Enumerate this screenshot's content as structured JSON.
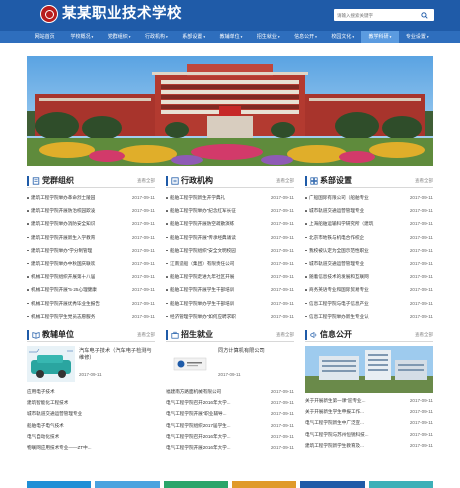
{
  "header": {
    "school_name": "某某职业技术学校",
    "search_placeholder": "请输入搜索关键字"
  },
  "nav": {
    "items": [
      {
        "label": "网站首页",
        "dropdown": false
      },
      {
        "label": "学校概况",
        "dropdown": true
      },
      {
        "label": "党群组织",
        "dropdown": true
      },
      {
        "label": "行政机构",
        "dropdown": true
      },
      {
        "label": "系部设置",
        "dropdown": true
      },
      {
        "label": "教辅单位",
        "dropdown": true
      },
      {
        "label": "招生就业",
        "dropdown": true
      },
      {
        "label": "信息公开",
        "dropdown": true
      },
      {
        "label": "校园文化",
        "dropdown": true
      },
      {
        "label": "教学科研",
        "dropdown": true,
        "active": true
      },
      {
        "label": "专业设置",
        "dropdown": true
      }
    ]
  },
  "banner": {
    "sign_text": "热烈欢迎"
  },
  "sections": {
    "party": {
      "title": "党群组织",
      "more": "查看全部",
      "items": [
        {
          "title": "建筑工程学院举办革命烈士陵园",
          "date": "2017-09-11"
        },
        {
          "title": "建筑工程学院开展防治校园欺凌",
          "date": "2017-09-11"
        },
        {
          "title": "建筑工程学院举办消防安全知识",
          "date": "2017-09-11"
        },
        {
          "title": "建筑工程学院开展新生入学教育",
          "date": "2017-09-11"
        },
        {
          "title": "建筑工程学院举办“学分制管理",
          "date": "2017-09-11"
        },
        {
          "title": "建筑工程学院举办中秋国庆联欢",
          "date": "2017-09-11"
        },
        {
          "title": "机械工程学院组织开展第十八届",
          "date": "2017-09-11"
        },
        {
          "title": "机械工程学院开展“5·25心理健康",
          "date": "2017-09-11"
        },
        {
          "title": "机械工程学院开展优秀毕业生报告",
          "date": "2017-09-11"
        },
        {
          "title": "机械工程学院学生党员志愿服务",
          "date": "2017-09-11"
        }
      ]
    },
    "admin": {
      "title": "行政机构",
      "more": "查看全部",
      "items": [
        {
          "title": "船舶工程学院新生开学典礼",
          "date": "2017-09-11"
        },
        {
          "title": "船舶工程学院举办“纪念红军长征",
          "date": "2017-09-11"
        },
        {
          "title": "船舶工程学院开展防空疏散演练",
          "date": "2017-09-11"
        },
        {
          "title": "船舶工程学院开展“传承经典诵读",
          "date": "2017-09-11"
        },
        {
          "title": "船舶工程学院组织“安全文明校园",
          "date": "2017-09-11"
        },
        {
          "title": "江南造船（集团）有限责任公司",
          "date": "2017-09-11"
        },
        {
          "title": "船舶工程学院走进九年社区开展",
          "date": "2017-09-11"
        },
        {
          "title": "船舶工程学院开展学生干部培训",
          "date": "2017-09-11"
        },
        {
          "title": "船舶工程学院举办学生干部培训",
          "date": "2017-09-11"
        },
        {
          "title": "经济管理学院举办“如何应聘求职",
          "date": "2017-09-11"
        }
      ]
    },
    "dept": {
      "title": "系部设置",
      "more": "查看全部",
      "items": [
        {
          "title": "广船国际有限公司（船舶专业",
          "date": "2017-09-11"
        },
        {
          "title": "城市轨道交通运营管理专业",
          "date": "2017-09-11"
        },
        {
          "title": "上海船舶运输科学研究所（建筑",
          "date": "2017-09-11"
        },
        {
          "title": "北京市地铁与机电合作校企",
          "date": "2017-09-11"
        },
        {
          "title": "我校被认定为全国示范性职业",
          "date": "2017-09-11"
        },
        {
          "title": "城市轨道交通运营管理专业",
          "date": "2017-09-11"
        },
        {
          "title": "随着信息技术的发展和互联网",
          "date": "2017-09-11"
        },
        {
          "title": "商务英语专业和国际贸易专业",
          "date": "2017-09-11"
        },
        {
          "title": "信息工程学院与电子信息产业",
          "date": "2017-09-11"
        },
        {
          "title": "信息工程学院举办新生专业认",
          "date": "2017-09-11"
        }
      ]
    },
    "aux": {
      "title": "教辅单位",
      "more": "查看全部",
      "feature_title": "汽车电子技术（汽车电子检测与维修）",
      "feature_date": "2017-09-11",
      "items": [
        {
          "title": "应用电子技术"
        },
        {
          "title": "建筑智能化工程技术"
        },
        {
          "title": "城市轨道交通运营管理专业"
        },
        {
          "title": "船舶电子电气技术"
        },
        {
          "title": "电气自动化技术"
        },
        {
          "title": "物联网应用技术专业——ZT中..."
        }
      ]
    },
    "jobs": {
      "title": "招生就业",
      "more": "查看全部",
      "feature_title": "同方计算机有限公司",
      "feature_date": "2017-09-11",
      "items": [
        {
          "title": "福建南方路面机械有限公司",
          "date": "2017-09-11"
        },
        {
          "title": "电气工程学院召开2016年大学...",
          "date": "2017-09-11"
        },
        {
          "title": "电气工程学院开展“职业辅导...",
          "date": "2017-09-11"
        },
        {
          "title": "电气工程学院组织2017届学生...",
          "date": "2017-09-11"
        },
        {
          "title": "电气工程学院召开2016年大学...",
          "date": "2017-09-11"
        },
        {
          "title": "电气工程学院开展2016年大学...",
          "date": "2017-09-11"
        }
      ]
    },
    "info": {
      "title": "信息公开",
      "more": "查看全部",
      "items": [
        {
          "title": "关于开展新生第一课“迎专业...",
          "date": "2017-09-11"
        },
        {
          "title": "关于开展新生学生申报工作...",
          "date": "2017-09-11"
        },
        {
          "title": "电气工程学院新生中广泛宣...",
          "date": "2017-09-11"
        },
        {
          "title": "电气工程学院与苏州恒锐科技...",
          "date": "2017-09-11"
        },
        {
          "title": "建筑工程学院新学生教育及...",
          "date": "2017-09-11"
        }
      ]
    }
  },
  "colors": {
    "header_blue": "#1f5ba8",
    "nav_blue": "#2e6ebd",
    "nav_active": "#5b9be0",
    "logo_red": "#b71c1c"
  }
}
